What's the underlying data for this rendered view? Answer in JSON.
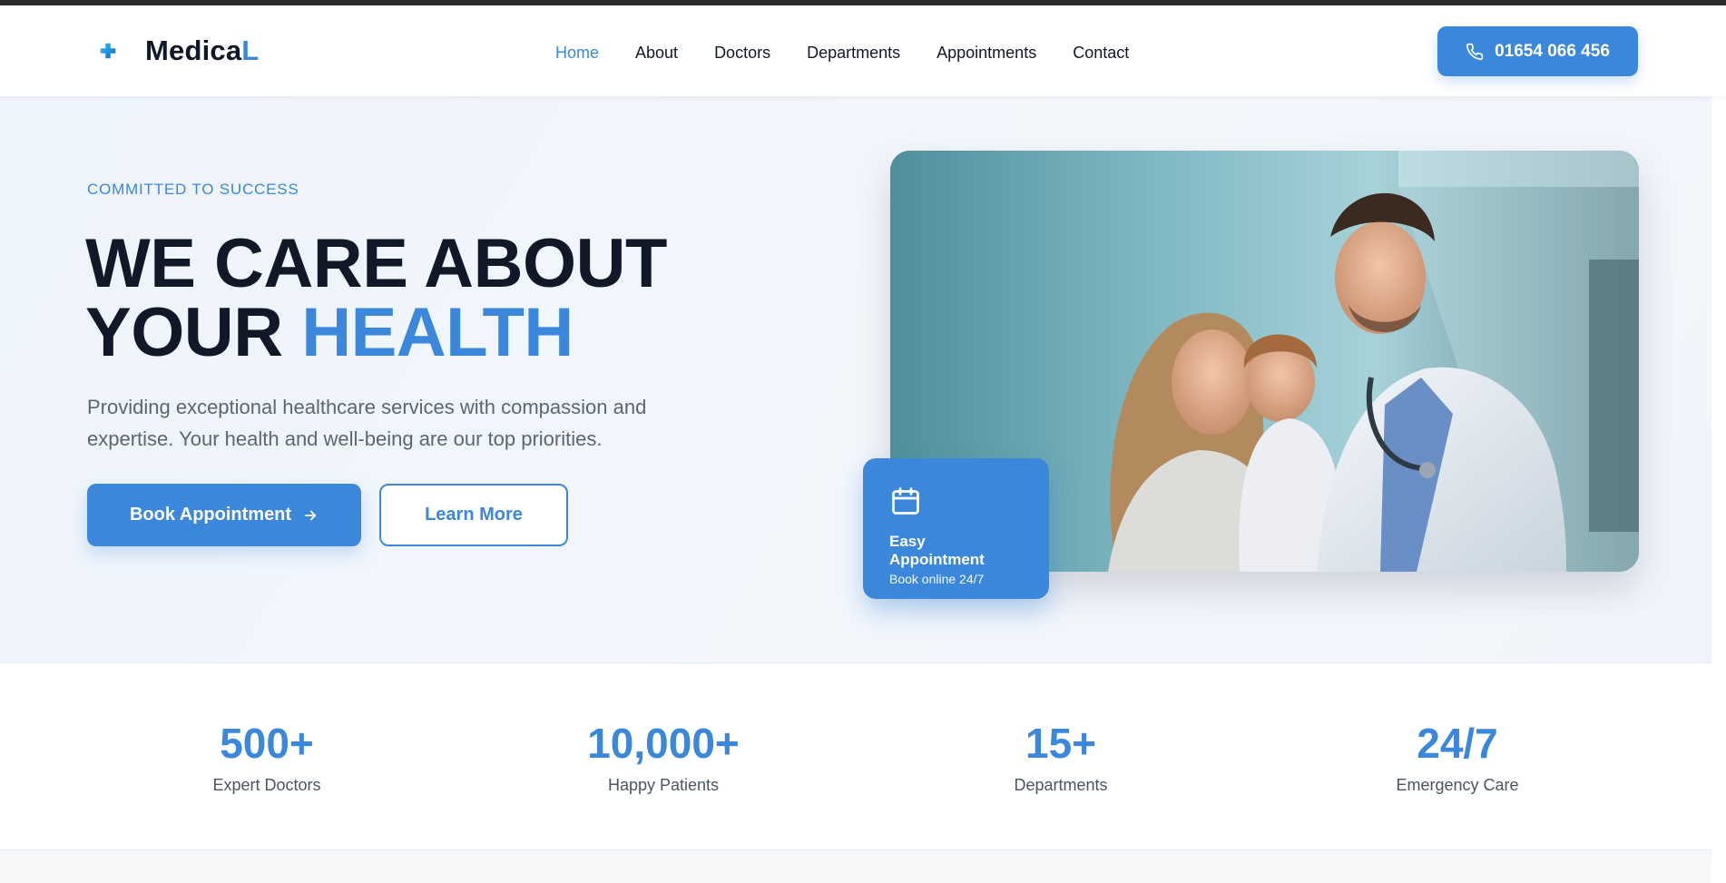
{
  "brand": {
    "name_main": "Medica",
    "name_accent": "L"
  },
  "nav": {
    "items": [
      {
        "label": "Home",
        "active": true
      },
      {
        "label": "About",
        "active": false
      },
      {
        "label": "Doctors",
        "active": false
      },
      {
        "label": "Departments",
        "active": false
      },
      {
        "label": "Appointments",
        "active": false
      },
      {
        "label": "Contact",
        "active": false
      }
    ]
  },
  "header": {
    "phone_label": "01654 066 456"
  },
  "hero": {
    "eyebrow": "COMMITTED TO SUCCESS",
    "title_line1": "WE CARE ABOUT",
    "title_line2_plain": "YOUR",
    "title_line2_accent": "HEALTH",
    "description": "Providing exceptional healthcare services with compassion and expertise. Your health and well-being are our top priorities.",
    "primary_cta": "Book Appointment",
    "secondary_cta": "Learn More"
  },
  "appointment_card": {
    "title": "Easy Appointment",
    "subtitle": "Book online 24/7"
  },
  "stats": [
    {
      "value": "500+",
      "label": "Expert Doctors"
    },
    {
      "value": "10,000+",
      "label": "Happy Patients"
    },
    {
      "value": "15+",
      "label": "Departments"
    },
    {
      "value": "24/7",
      "label": "Emergency Care"
    }
  ],
  "colors": {
    "accent": "#3b87dc",
    "heading": "#111827",
    "body_text": "#5b6675",
    "hero_bg": "#eef4fb"
  },
  "icons": {
    "logo": "medical-cross-icon",
    "phone": "phone-icon",
    "cta_arrow": "arrow-right-icon",
    "card": "calendar-icon"
  }
}
